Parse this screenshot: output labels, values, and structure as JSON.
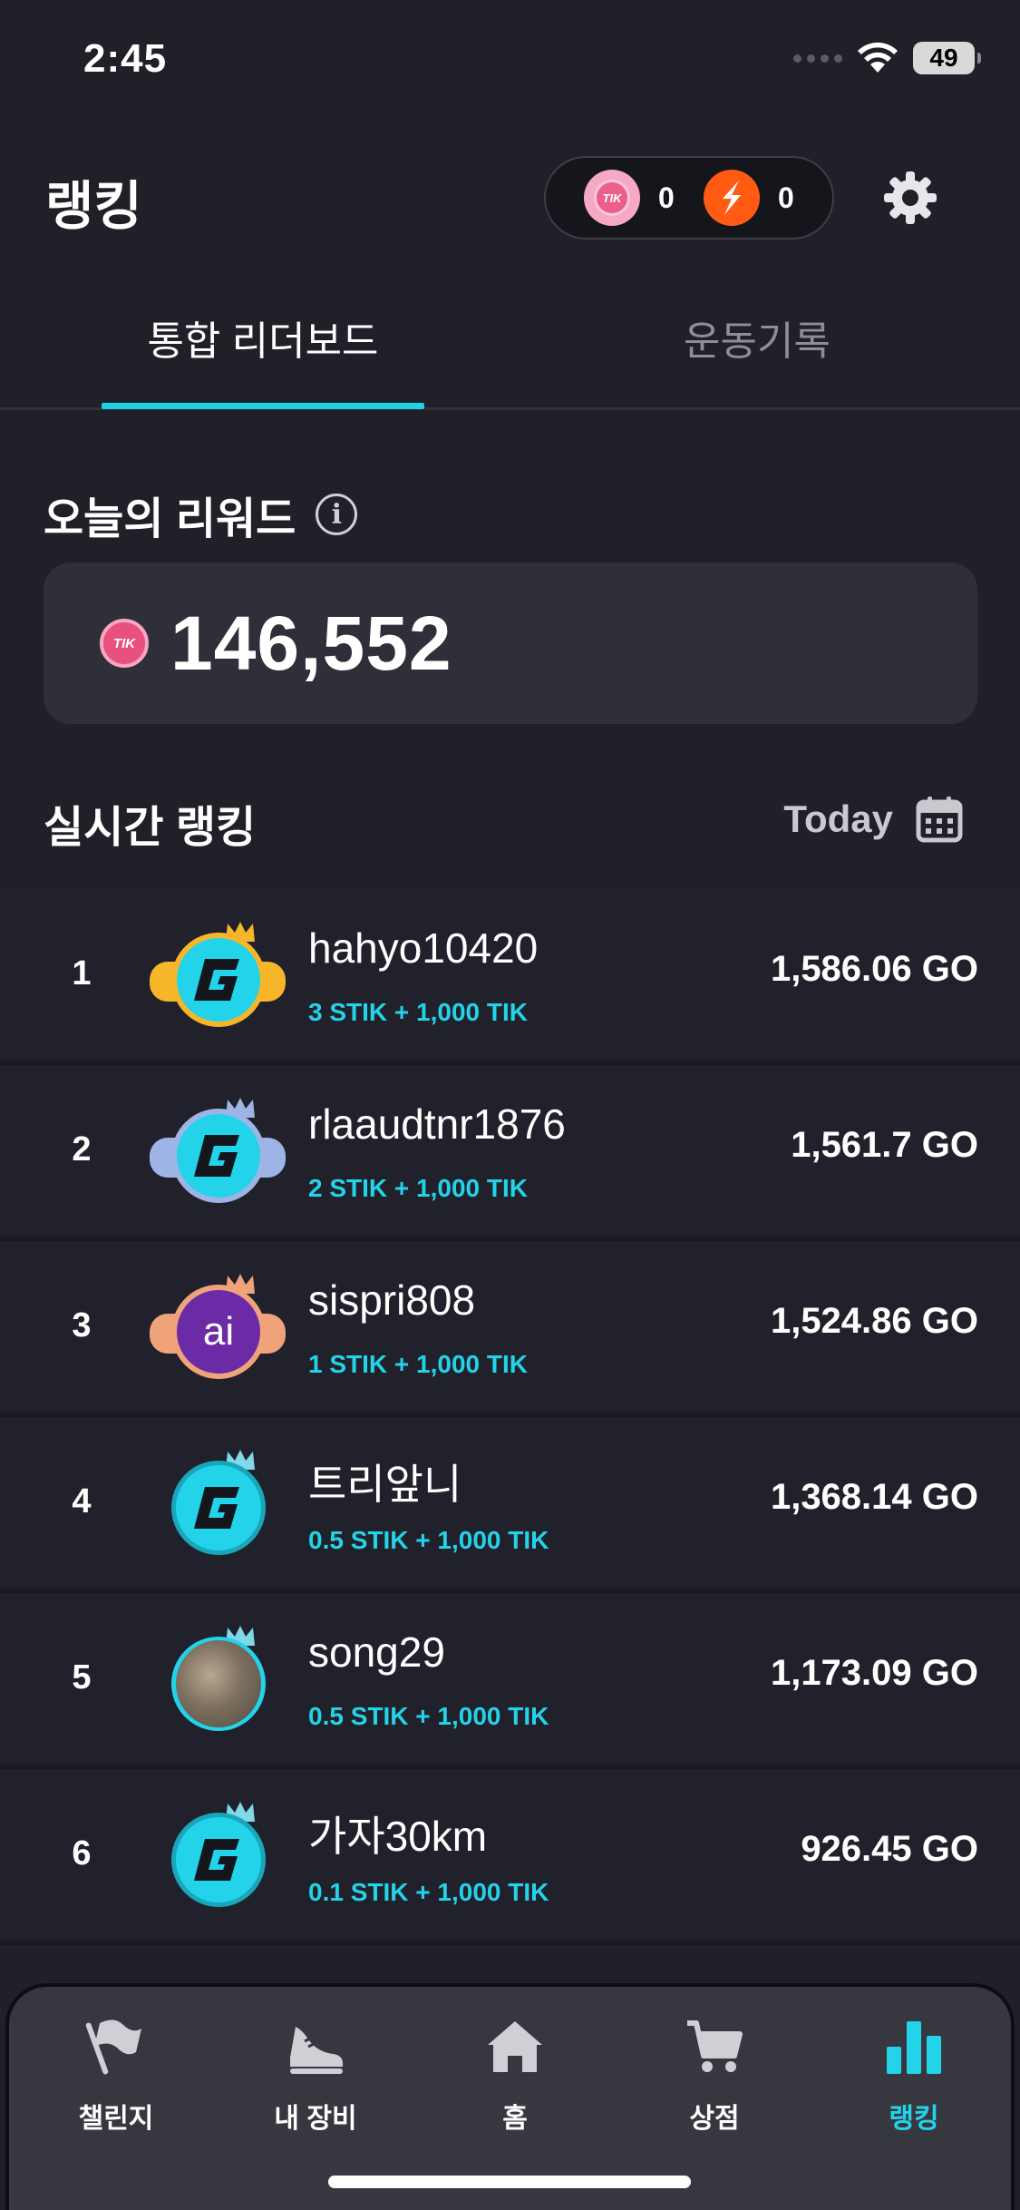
{
  "status_bar": {
    "time": "2:45",
    "battery": "49"
  },
  "header": {
    "title": "랭킹",
    "tik_count": "0",
    "stik_count": "0",
    "tik_coin_text": "TIK"
  },
  "tabs": [
    {
      "label": "통합 리더보드",
      "active": true
    },
    {
      "label": "운동기록",
      "active": false
    }
  ],
  "reward": {
    "title": "오늘의 리워드",
    "value": "146,552",
    "coin_text": "TIK"
  },
  "ranking": {
    "title": "실시간 랭킹",
    "date_filter": "Today",
    "rows": [
      {
        "rank": "1",
        "name": "hahyo10420",
        "reward": "3 STIK + 1,000 TIK",
        "score": "1,586.06 GO",
        "avatar": "g-logo"
      },
      {
        "rank": "2",
        "name": "rlaaudtnr1876",
        "reward": "2 STIK + 1,000 TIK",
        "score": "1,561.7 GO",
        "avatar": "g-logo"
      },
      {
        "rank": "3",
        "name": "sispri808",
        "reward": "1 STIK + 1,000 TIK",
        "score": "1,524.86 GO",
        "avatar": "ai",
        "avatar_text": "ai"
      },
      {
        "rank": "4",
        "name": "트리앞니",
        "reward": "0.5 STIK + 1,000 TIK",
        "score": "1,368.14 GO",
        "avatar": "g-logo"
      },
      {
        "rank": "5",
        "name": "song29",
        "reward": "0.5 STIK + 1,000 TIK",
        "score": "1,173.09 GO",
        "avatar": "photo"
      },
      {
        "rank": "6",
        "name": "가자30km",
        "reward": "0.1 STIK + 1,000 TIK",
        "score": "926.45 GO",
        "avatar": "g-logo"
      }
    ]
  },
  "bottom_nav": [
    {
      "label": "챌린지",
      "icon": "flag-icon",
      "active": false
    },
    {
      "label": "내 장비",
      "icon": "sneaker-icon",
      "active": false
    },
    {
      "label": "홈",
      "icon": "home-icon",
      "active": false
    },
    {
      "label": "상점",
      "icon": "cart-icon",
      "active": false
    },
    {
      "label": "랭킹",
      "icon": "bar-chart-icon",
      "active": true
    }
  ],
  "colors": {
    "background": "#1f2028",
    "accent": "#22d3ea",
    "tik_pink": "#ec5f8b",
    "stik_orange": "#ff5b12",
    "gold": "#f6b62a",
    "silver": "#9fb4e6",
    "bronze": "#f0a27a"
  }
}
